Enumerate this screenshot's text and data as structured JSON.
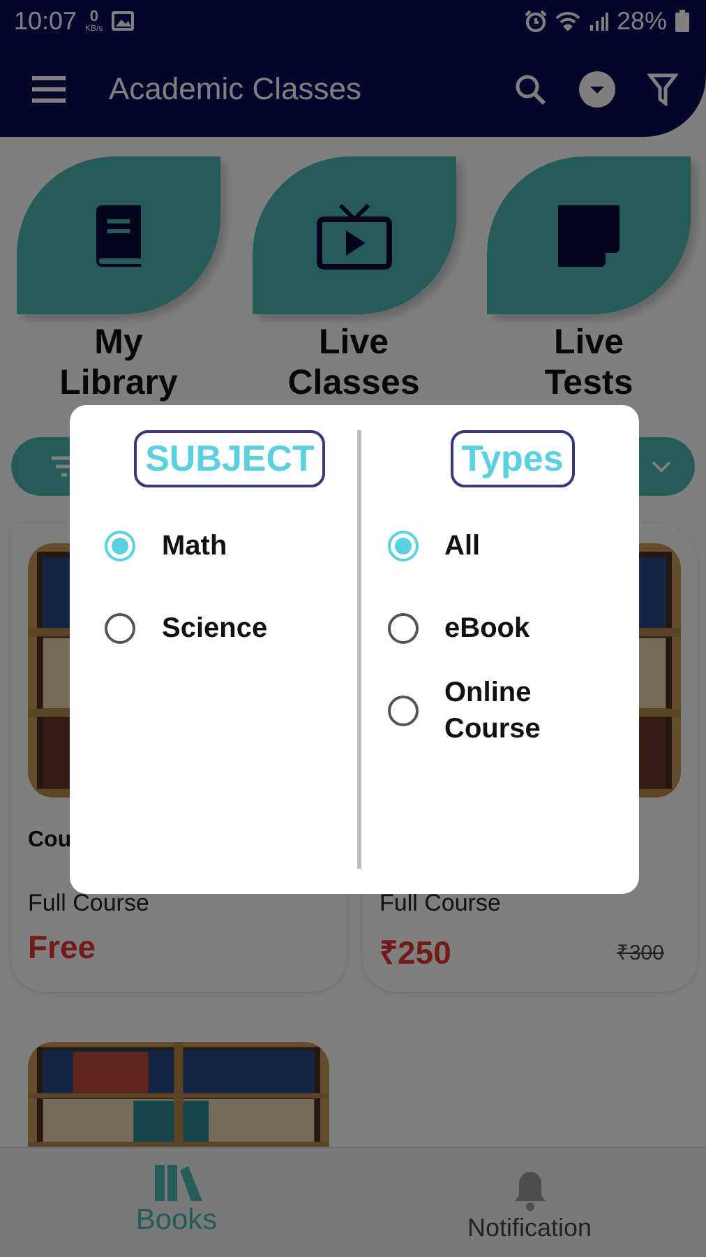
{
  "status_bar": {
    "time": "10:07",
    "speed_value": "0",
    "speed_unit": "KB/s",
    "battery": "28%"
  },
  "app_bar": {
    "title": "Academic Classes"
  },
  "shortcuts": [
    {
      "label": "My Library"
    },
    {
      "label": "Live Classes"
    },
    {
      "label": "Live Tests"
    }
  ],
  "courses": [
    {
      "title": "Cou",
      "subtitle": "Full Course",
      "price": "Free"
    },
    {
      "subtitle": "Full Course",
      "price": "₹250",
      "old_price": "₹300"
    },
    {
      "kind": "picture"
    }
  ],
  "bottom_nav": [
    {
      "label": "Books",
      "selected": true
    },
    {
      "label": "Notification",
      "selected": false
    }
  ],
  "dialog": {
    "columns": [
      {
        "heading": "SUBJECT",
        "options": [
          {
            "label": "Math",
            "selected": true
          },
          {
            "label": "Science",
            "selected": false
          }
        ]
      },
      {
        "heading": "Types",
        "options": [
          {
            "label": "All",
            "selected": true
          },
          {
            "label": "eBook",
            "selected": false
          },
          {
            "label": "Online Course",
            "selected": false
          }
        ]
      }
    ]
  }
}
